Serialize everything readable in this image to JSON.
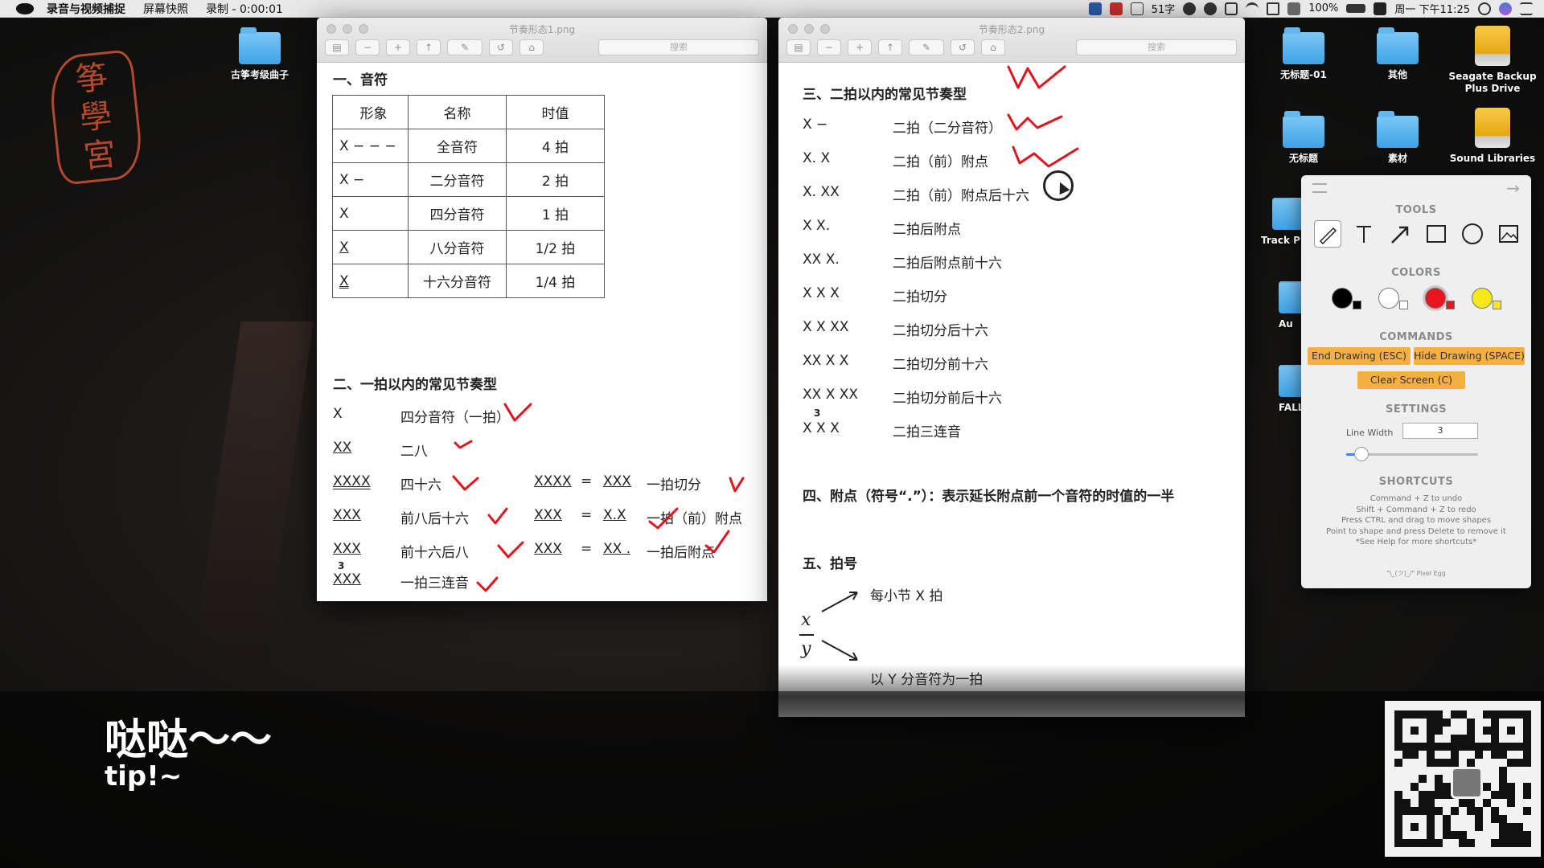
{
  "menubar": {
    "app_name": "录音与视频捕捉",
    "menu_items": [
      "屏幕快照",
      "录制 - 0:00:01"
    ],
    "input_indicator": "51字",
    "battery": "100%",
    "clock": "周一 下午11:25"
  },
  "desktop": {
    "icons": [
      {
        "label": "古筝考级曲子"
      },
      {
        "label": "无标题-01"
      },
      {
        "label": "其他"
      },
      {
        "label": "Seagate Backup Plus Drive"
      },
      {
        "label": "无标题"
      },
      {
        "label": "素材"
      },
      {
        "label": "Sound Libraries"
      },
      {
        "label": "Track P"
      },
      {
        "label": "Au"
      },
      {
        "label": "FALL"
      }
    ],
    "seal_text": [
      "筝",
      "學",
      "宮"
    ]
  },
  "window1": {
    "title": "节奏形态1.png",
    "search_placeholder": "搜索",
    "section1": "一、音符",
    "table": {
      "headers": [
        "形象",
        "名称",
        "时值"
      ],
      "rows": [
        [
          "X − − −",
          "全音符",
          "4 拍"
        ],
        [
          "X −",
          "二分音符",
          "2 拍"
        ],
        [
          "X",
          "四分音符",
          "1 拍"
        ],
        [
          "X",
          "八分音符",
          "1/2 拍"
        ],
        [
          "X",
          "十六分音符",
          "1/4 拍"
        ]
      ]
    },
    "section2": "二、一拍以内的常见节奏型",
    "rhythms": [
      {
        "sym": "X",
        "name": "四分音符（一拍）"
      },
      {
        "sym": "XX",
        "name": "二八"
      },
      {
        "sym": "XXXX",
        "name": "四十六",
        "eq_left": "XXXX",
        "eq": "=",
        "eq_right": "XXX",
        "eq_name": "一拍切分"
      },
      {
        "sym": "XXX",
        "name": "前八后十六",
        "eq_left": "XXX",
        "eq": "=",
        "eq_right": "X.X",
        "eq_name": "一拍（前）附点"
      },
      {
        "sym": "XXX",
        "name": "前十六后八",
        "eq_left": "XXX",
        "eq": "=",
        "eq_right": "XX .",
        "eq_name": "一拍后附点"
      },
      {
        "sym": "XXX",
        "triplet": "3",
        "name": "一拍三连音"
      }
    ]
  },
  "window2": {
    "title": "节奏形态2.png",
    "search_placeholder": "搜索",
    "section3": "三、二拍以内的常见节奏型",
    "rhythms": [
      {
        "sym": "X  −",
        "name": "二拍（二分音符）"
      },
      {
        "sym": "X.  X",
        "name": "二拍（前）附点"
      },
      {
        "sym": "X.  XX",
        "name": "二拍（前）附点后十六"
      },
      {
        "sym": "X X.",
        "name": "二拍后附点"
      },
      {
        "sym": "XX X.",
        "name": "二拍后附点前十六"
      },
      {
        "sym": "X X  X",
        "name": "二拍切分"
      },
      {
        "sym": "X X  XX",
        "name": "二拍切分后十六"
      },
      {
        "sym": "XX X  X",
        "name": "二拍切分前十六"
      },
      {
        "sym": "XX X  XX",
        "name": "二拍切分前后十六"
      },
      {
        "sym": "X X X",
        "triplet": "3",
        "name": "二拍三连音"
      }
    ],
    "section4": "四、附点（符号“.”）：表示延长附点前一个音符的时值的一半",
    "section5": "五、拍号",
    "ts_top": "x",
    "ts_bottom": "y",
    "ts_desc_top": "每小节 X 拍",
    "ts_desc_bottom": "以 Y 分音符为一拍"
  },
  "panel": {
    "tools_title": "TOOLS",
    "tools": [
      "pen-icon",
      "text-icon",
      "arrow-icon",
      "rectangle-icon",
      "circle-icon",
      "image-icon"
    ],
    "colors_title": "COLORS",
    "colors": [
      "#000000",
      "#ffffff",
      "#e8141e",
      "#f5e91e"
    ],
    "selected_color": "#e8141e",
    "commands_title": "COMMANDS",
    "end_drawing": "End Drawing (ESC)",
    "hide_drawing": "Hide Drawing (SPACE)",
    "clear_screen": "Clear Screen (C)",
    "settings_title": "SETTINGS",
    "line_width_label": "Line Width",
    "line_width_value": "3",
    "line_width_fraction": 0.06,
    "shortcuts_title": "SHORTCUTS",
    "shortcuts": [
      "Command + Z to undo",
      "Shift + Command + Z to redo",
      "Press CTRL and drag to move shapes",
      "Point to shape and press Delete to remove it",
      "*See Help for more shortcuts*"
    ],
    "footer": "\"\\_(ツ)_/\" Pixel Egg"
  },
  "overlay": {
    "caption_main": "哒哒～～",
    "caption_sub": "tip!~"
  }
}
